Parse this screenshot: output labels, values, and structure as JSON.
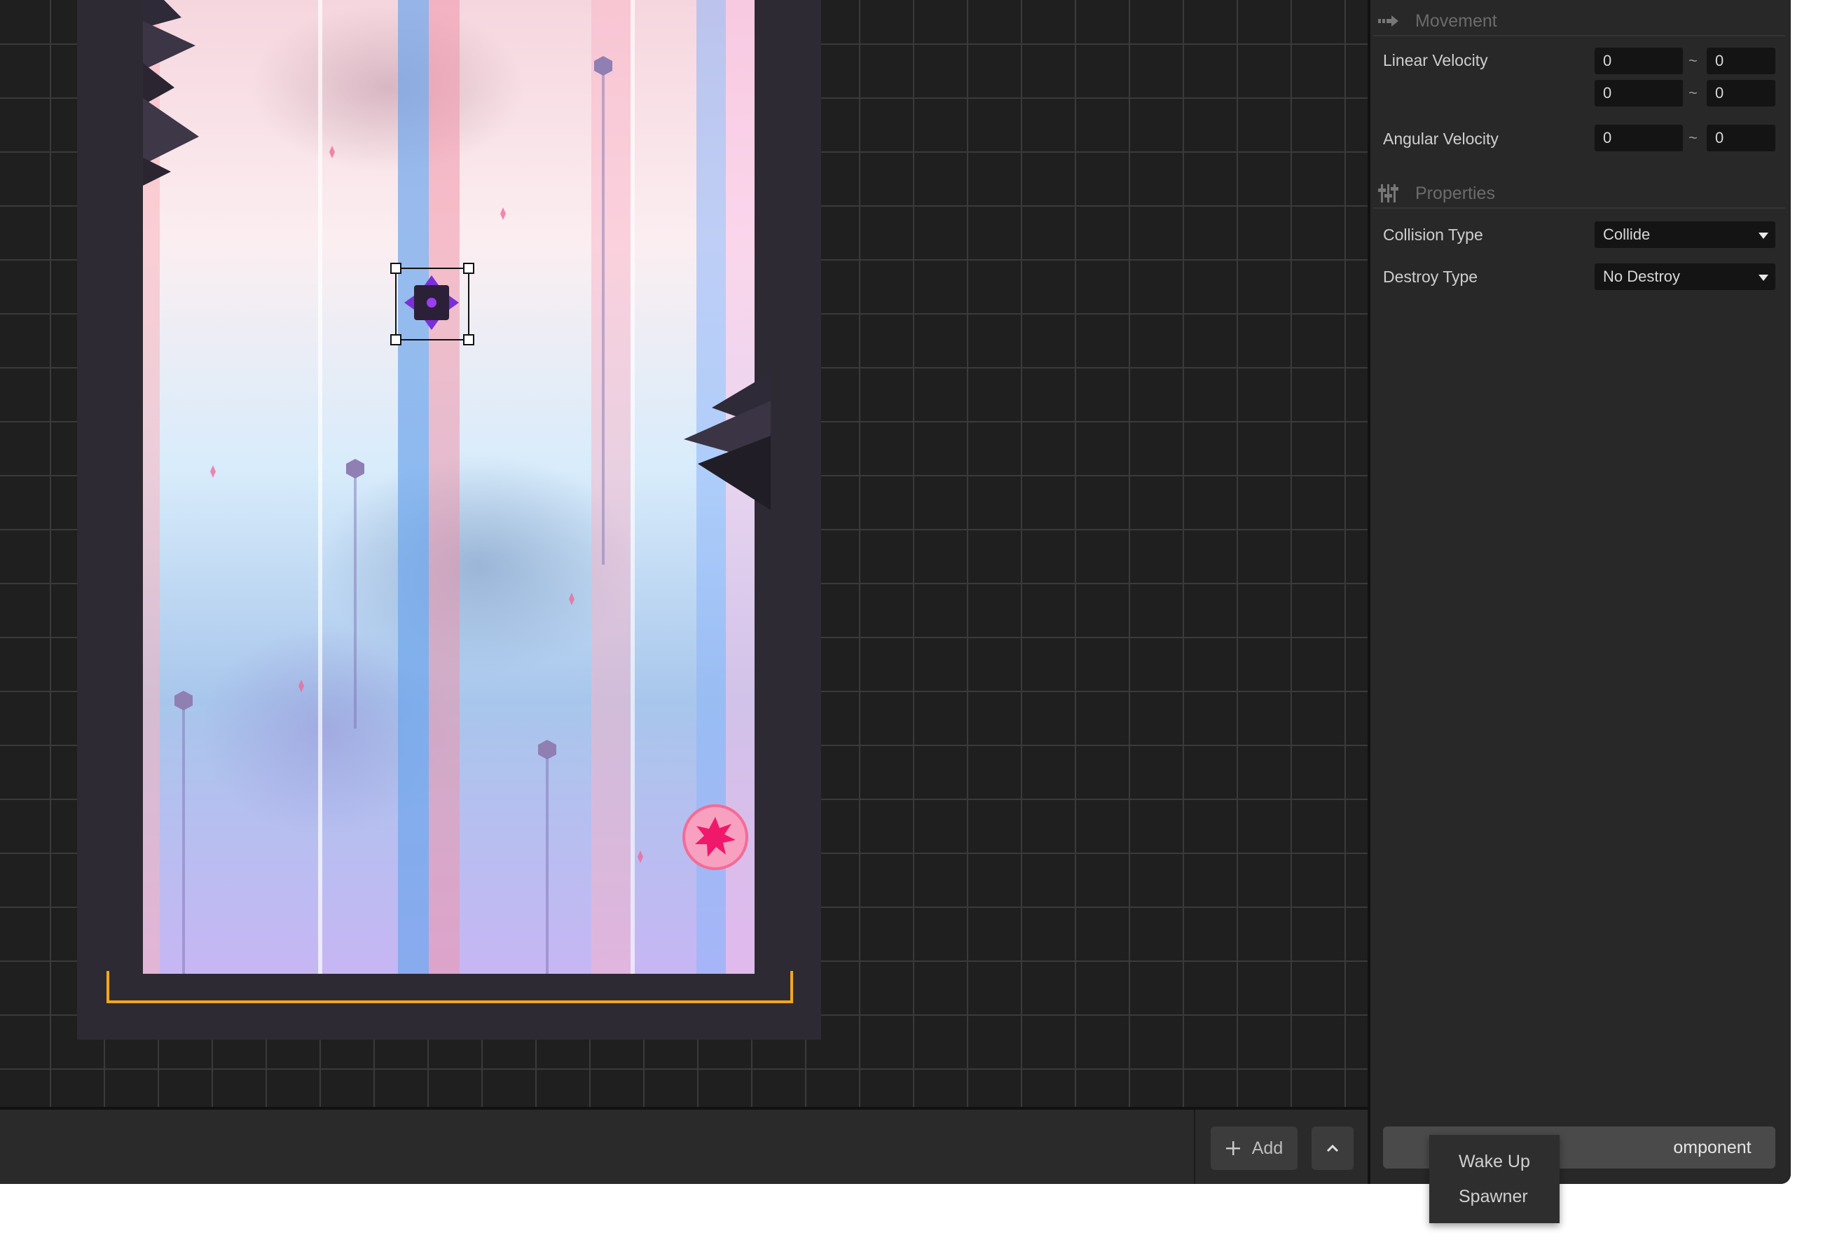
{
  "inspector": {
    "movement": {
      "title": "Movement",
      "icon": "arrow-right-icon",
      "linear_velocity": {
        "label": "Linear Velocity",
        "x_min": "0",
        "x_max": "0",
        "y_min": "0",
        "y_max": "0"
      },
      "angular_velocity": {
        "label": "Angular Velocity",
        "min": "0",
        "max": "0"
      },
      "range_separator": "~"
    },
    "properties": {
      "title": "Properties",
      "icon": "sliders-icon",
      "collision_type": {
        "label": "Collision Type",
        "value": "Collide"
      },
      "destroy_type": {
        "label": "Destroy Type",
        "value": "No Destroy"
      }
    },
    "add_component_label": "Add Component",
    "add_component_visible_text": "omponent"
  },
  "component_menu": {
    "items": [
      "Wake Up",
      "Spawner"
    ]
  },
  "bottom_bar": {
    "add_label": "Add",
    "add_icon": "plus-icon",
    "expand_icon": "chevron-up-icon"
  },
  "colors": {
    "goal_bracket": "#f0a81c",
    "selection_outline": "#111111",
    "orb": "#f46b98"
  }
}
